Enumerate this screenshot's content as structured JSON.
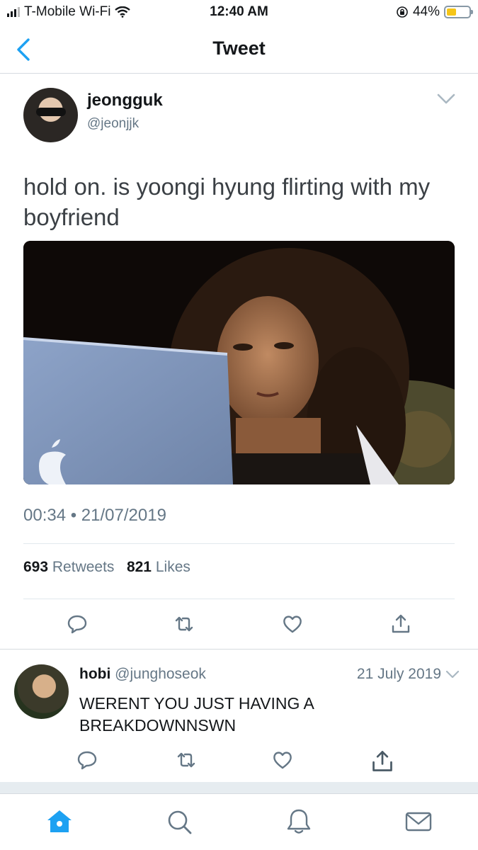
{
  "status_bar": {
    "carrier": "T-Mobile Wi-Fi",
    "time": "12:40 AM",
    "battery_percent": "44%",
    "battery_level": 0.44,
    "battery_color": "#f5c518"
  },
  "nav": {
    "title": "Tweet",
    "back_icon": "chevron-left-icon"
  },
  "tweet": {
    "author_name": "jeongguk",
    "author_handle": "@jeonjjk",
    "text": "hold on. is yoongi hyung flirting with my boyfriend",
    "timestamp": "00:34 • 21/07/2019",
    "retweets_count": "693",
    "retweets_label": "Retweets",
    "likes_count": "821",
    "likes_label": "Likes"
  },
  "reply": {
    "author_name": "hobi",
    "author_handle": "@junghoseok",
    "date": "21 July 2019",
    "text": "WERENT YOU JUST HAVING A BREAKDOWNNSWN"
  },
  "tab_bar": {
    "items": [
      "home-icon",
      "search-icon",
      "notifications-icon",
      "messages-icon"
    ],
    "active": "home-icon"
  },
  "colors": {
    "accent": "#1da1f2",
    "secondary_text": "#657786",
    "icon_gray": "#657786"
  }
}
